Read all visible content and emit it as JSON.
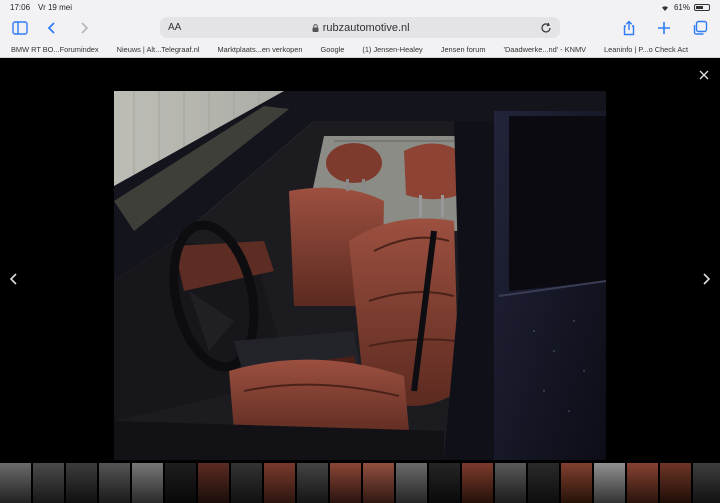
{
  "status": {
    "time": "17:06",
    "date": "Vr 19 mei",
    "battery": "61%",
    "battery_level": 0.61
  },
  "toolbar": {
    "text_size": "AA",
    "url": "rubzautomotive.nl"
  },
  "bookmarks": [
    "BMW RT BO...Forumindex",
    "Nieuws | Alt...Telegraaf.nl",
    "Marktplaats...en verkopen",
    "Google",
    "(1) Jensen-Healey",
    "Jensen forum",
    "'Daadwerke...nd' - KNMV",
    "Leaninfo | P...o Check Act"
  ],
  "colors": {
    "accent": "#2f7cf6",
    "chrome": "#f2f2f4",
    "backdrop": "#000000",
    "leather": "#7a3a2c"
  },
  "icons": {
    "sidebar": "sidebar-icon",
    "back": "chevron-left-icon",
    "forward": "chevron-right-icon",
    "share": "share-icon",
    "new_tab": "plus-icon",
    "tabs": "tabs-icon",
    "close": "close-icon",
    "prev": "chevron-left-icon",
    "next": "chevron-right-icon"
  }
}
